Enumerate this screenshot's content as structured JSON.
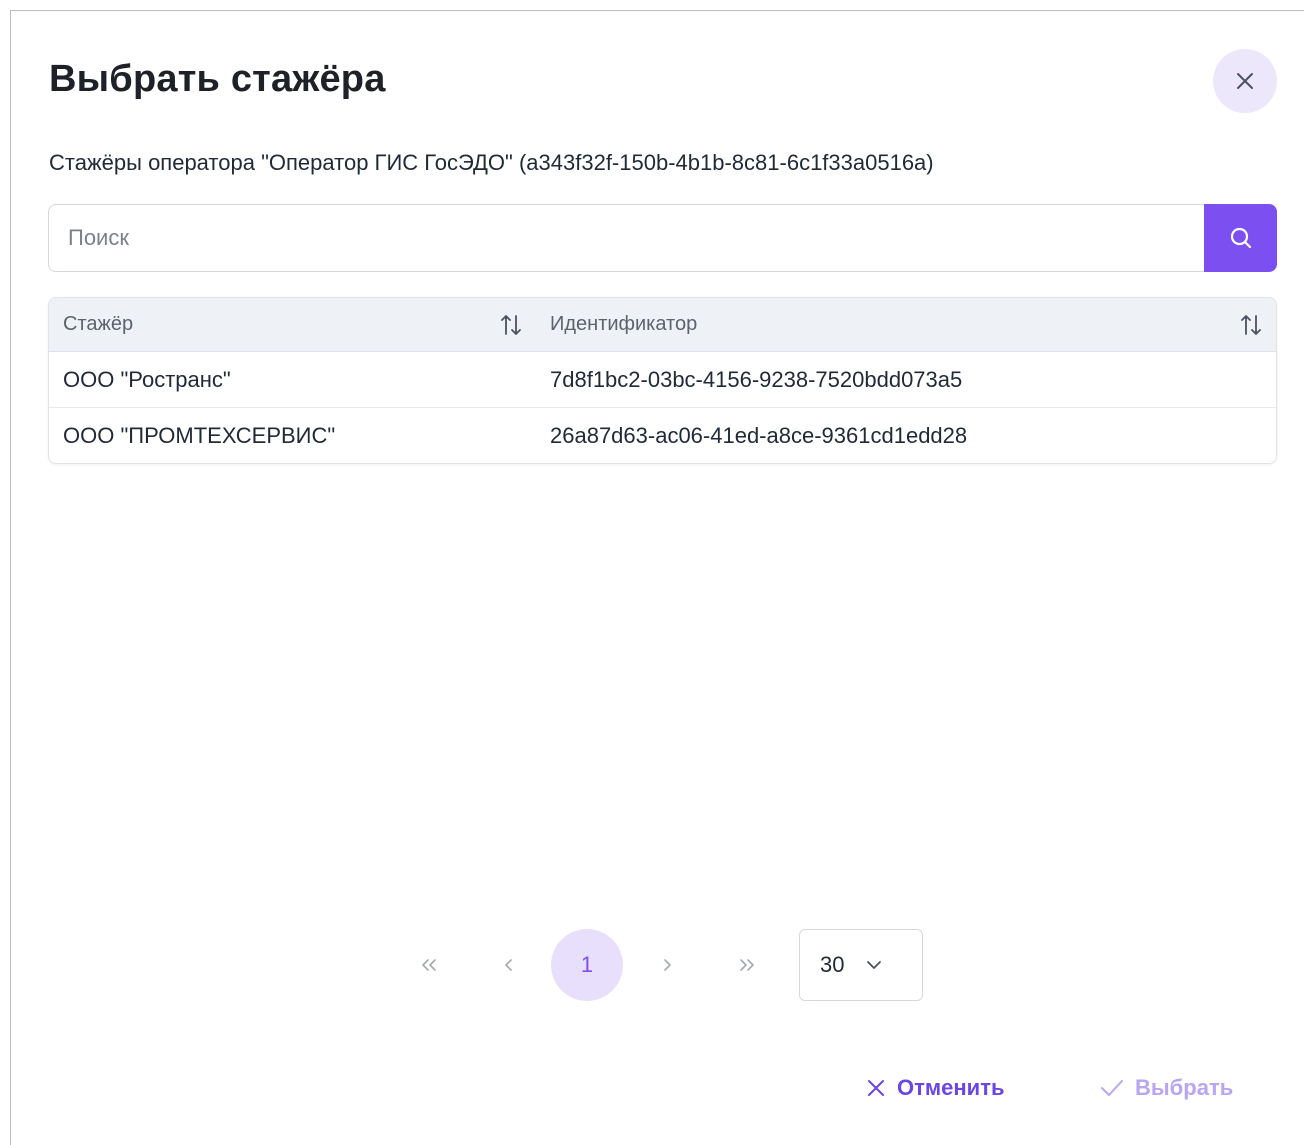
{
  "dialog": {
    "title": "Выбрать стажёра",
    "subtitle": "Стажёры оператора \"Оператор ГИС ГосЭДО\" (a343f32f-150b-4b1b-8c81-6c1f33a0516a)"
  },
  "search": {
    "placeholder": "Поиск",
    "value": ""
  },
  "table": {
    "columns": [
      "Стажёр",
      "Идентификатор"
    ],
    "rows": [
      [
        "ООО \"Ространс\"",
        "7d8f1bc2-03bc-4156-9238-7520bdd073a5"
      ],
      [
        "ООО \"ПРОМТЕХСЕРВИС\"",
        "26a87d63-ac06-41ed-a8ce-9361cd1edd28"
      ]
    ]
  },
  "pagination": {
    "current_page": "1",
    "page_size": "30"
  },
  "footer": {
    "cancel_label": "Отменить",
    "select_label": "Выбрать"
  },
  "colors": {
    "accent": "#7c4ff0",
    "accent_light": "#ece7fb"
  }
}
